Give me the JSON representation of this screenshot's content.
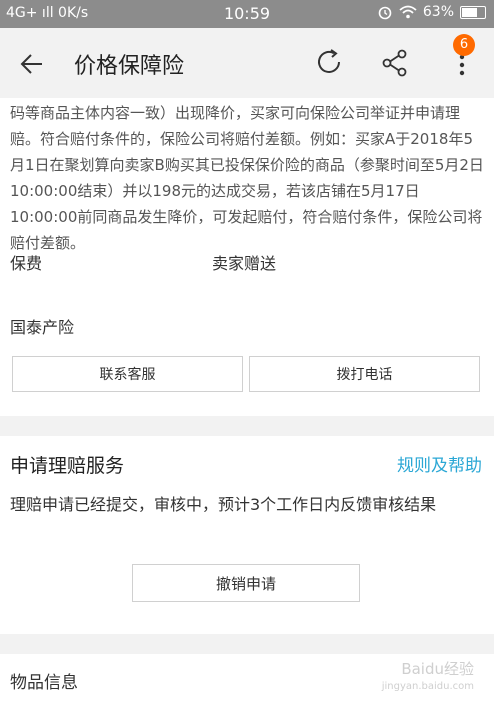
{
  "status": {
    "left": "4G+ ıll 0K/s",
    "time": "10:59",
    "battery": "63%"
  },
  "nav": {
    "title": "价格保障险",
    "badge": "6"
  },
  "insurance": {
    "description": "码等商品主体内容一致）出现降价，买家可向保险公司举证并申请理赔。符合赔付条件的，保险公司将赔付差额。例如：买家A于2018年5月1日在聚划算向卖家B购买其已投保保价险的商品（参聚时间至5月2日10:00:00结束）并以198元的达成交易，若该店铺在5月17日10:00:00前同商品发生降价，可发起赔付，符合赔付条件，保险公司将赔付差额。",
    "fee_label": "保费",
    "fee_value": "卖家赠送",
    "insurer": "国泰产险",
    "contact_button": "联系客服",
    "call_button": "拨打电话"
  },
  "claim": {
    "title": "申请理赔服务",
    "help_link": "规则及帮助",
    "status_text": "理赔申请已经提交，审核中，预计3个工作日内反馈审核结果",
    "cancel_button": "撤销申请"
  },
  "item": {
    "title": "物品信息"
  },
  "watermark": {
    "brand": "Baidu经验",
    "url": "jingyan.baidu.com"
  }
}
